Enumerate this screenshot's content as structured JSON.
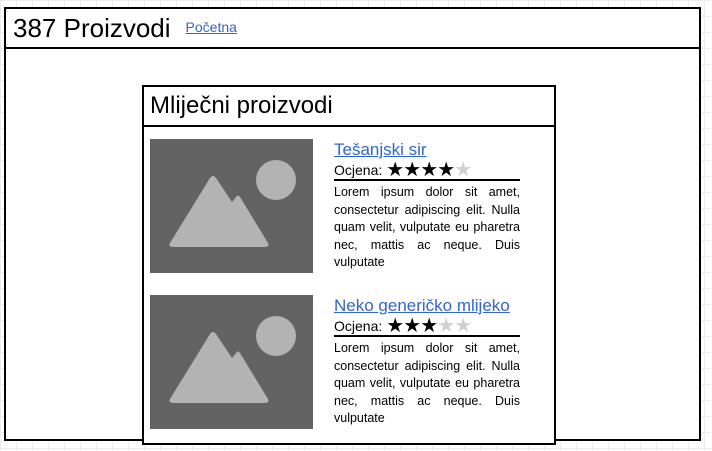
{
  "header": {
    "title": "387 Proizvodi",
    "home_link": "Početna"
  },
  "category": {
    "title": "Mliječni proizvodi"
  },
  "products": [
    {
      "name": "Tešanjski sir",
      "rating_label": "Ocjena:",
      "rating": 4,
      "rating_max": 5,
      "description": "Lorem ipsum dolor sit amet, consectetur adipiscing elit. Nulla quam velit, vulputate eu pharetra nec, mattis ac neque. Duis vulputate",
      "image_icon": "image-placeholder-icon"
    },
    {
      "name": "Neko generičko mlijeko",
      "rating_label": "Ocjena:",
      "rating": 3,
      "rating_max": 5,
      "description": "Lorem ipsum dolor sit amet, consectetur adipiscing elit. Nulla quam velit, vulputate eu pharetra nec, mattis ac neque. Duis vulputate",
      "image_icon": "image-placeholder-icon"
    }
  ],
  "colors": {
    "link": "#3366cc",
    "thumb_bg": "#636363",
    "thumb_shape": "#b3b3b3",
    "star_on": "#000000",
    "star_off": "#d0d0d0"
  }
}
